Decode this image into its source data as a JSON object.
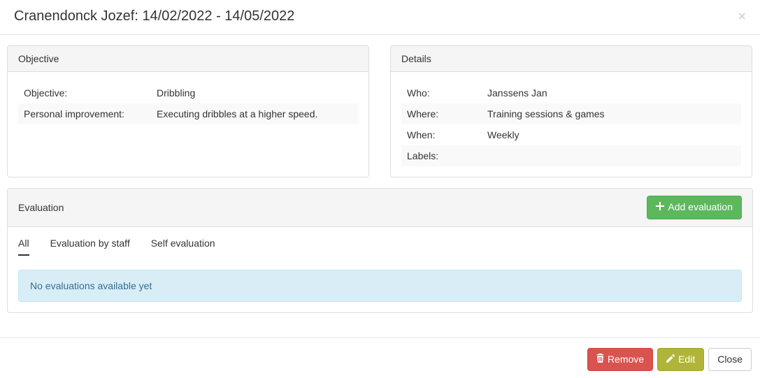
{
  "header": {
    "title": "Cranendonck Jozef: 14/02/2022 - 14/05/2022"
  },
  "objective": {
    "heading": "Objective",
    "rows": [
      {
        "label": "Objective:",
        "value": "Dribbling"
      },
      {
        "label": "Personal improvement:",
        "value": "Executing dribbles at a higher speed."
      }
    ]
  },
  "details": {
    "heading": "Details",
    "rows": [
      {
        "label": "Who:",
        "value": "Janssens Jan"
      },
      {
        "label": "Where:",
        "value": "Training sessions & games"
      },
      {
        "label": "When:",
        "value": "Weekly"
      },
      {
        "label": "Labels:",
        "value": ""
      }
    ]
  },
  "evaluation": {
    "heading": "Evaluation",
    "add_label": "Add evaluation",
    "tabs": {
      "all": "All",
      "by_staff": "Evaluation by staff",
      "self": "Self evaluation"
    },
    "empty_message": "No evaluations available yet"
  },
  "footer": {
    "remove": "Remove",
    "edit": "Edit",
    "close": "Close"
  }
}
